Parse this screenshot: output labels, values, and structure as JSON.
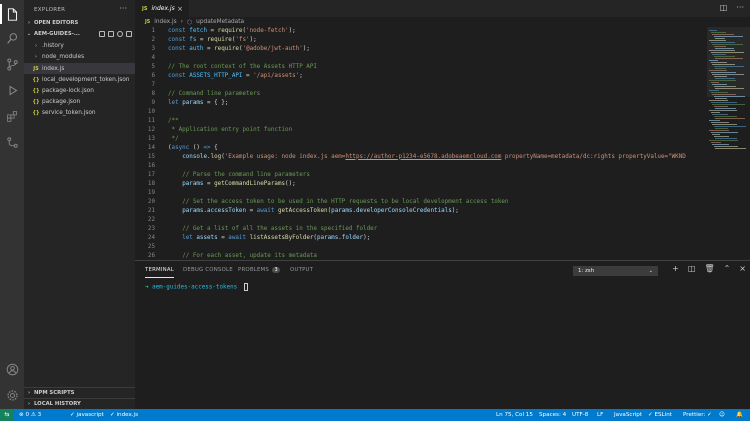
{
  "sidebar": {
    "title": "EXPLORER",
    "more": "···",
    "open_editors": "OPEN EDITORS",
    "project": "AEM-GUIDES-...",
    "items": [
      {
        "label": ".history",
        "kind": "folder"
      },
      {
        "label": "node_modules",
        "kind": "folder"
      },
      {
        "label": "index.js",
        "kind": "js"
      },
      {
        "label": "local_development_token.json",
        "kind": "json"
      },
      {
        "label": "package-lock.json",
        "kind": "json"
      },
      {
        "label": "package.json",
        "kind": "json"
      },
      {
        "label": "service_token.json",
        "kind": "json"
      }
    ],
    "npm_scripts": "NPM SCRIPTS",
    "local_history": "LOCAL HISTORY"
  },
  "editor": {
    "tab_label": "index.js",
    "breadcrumb_file": "index.js",
    "breadcrumb_symbol": "updateMetadata",
    "lines": [
      {
        "n": "1",
        "parts": [
          [
            "kw",
            "const "
          ],
          [
            "vr",
            "fetch"
          ],
          [
            "tx",
            " = "
          ],
          [
            "fn",
            "require"
          ],
          [
            "tx",
            "("
          ],
          [
            "st",
            "'node-fetch'"
          ],
          [
            "tx",
            ");"
          ]
        ]
      },
      {
        "n": "2",
        "parts": [
          [
            "kw",
            "const "
          ],
          [
            "vr",
            "fs"
          ],
          [
            "tx",
            " = "
          ],
          [
            "fn",
            "require"
          ],
          [
            "tx",
            "("
          ],
          [
            "st",
            "'fs'"
          ],
          [
            "tx",
            ");"
          ]
        ]
      },
      {
        "n": "3",
        "parts": [
          [
            "kw",
            "const "
          ],
          [
            "vr",
            "auth"
          ],
          [
            "tx",
            " = "
          ],
          [
            "fn",
            "require"
          ],
          [
            "tx",
            "("
          ],
          [
            "st",
            "'@adobe/jwt-auth'"
          ],
          [
            "tx",
            ");"
          ]
        ]
      },
      {
        "n": "4",
        "parts": []
      },
      {
        "n": "5",
        "parts": [
          [
            "cm",
            "// The root context of the Assets HTTP API"
          ]
        ]
      },
      {
        "n": "6",
        "parts": [
          [
            "kw",
            "const "
          ],
          [
            "vr",
            "ASSETS_HTTP_API"
          ],
          [
            "tx",
            " = "
          ],
          [
            "st",
            "'/api/assets'"
          ],
          [
            "tx",
            ";"
          ]
        ]
      },
      {
        "n": "7",
        "parts": []
      },
      {
        "n": "8",
        "parts": [
          [
            "cm",
            "// Command line parameters"
          ]
        ]
      },
      {
        "n": "9",
        "parts": [
          [
            "kw",
            "let "
          ],
          [
            "id",
            "params"
          ],
          [
            "tx",
            " = { };"
          ]
        ]
      },
      {
        "n": "10",
        "parts": []
      },
      {
        "n": "11",
        "parts": [
          [
            "cm",
            "/**"
          ]
        ]
      },
      {
        "n": "12",
        "parts": [
          [
            "cm",
            " * Application entry point function"
          ]
        ]
      },
      {
        "n": "13",
        "parts": [
          [
            "cm",
            " */"
          ]
        ]
      },
      {
        "n": "14",
        "parts": [
          [
            "tx",
            "("
          ],
          [
            "kw",
            "async "
          ],
          [
            "tx",
            "() "
          ],
          [
            "kw",
            "=>"
          ],
          [
            "tx",
            " {"
          ]
        ]
      },
      {
        "n": "15",
        "parts": [
          [
            "tx",
            "    "
          ],
          [
            "id",
            "console"
          ],
          [
            "tx",
            "."
          ],
          [
            "fn",
            "log"
          ],
          [
            "tx",
            "("
          ],
          [
            "st",
            "'Example usage: node index.js aem="
          ],
          [
            "stu",
            "https://author-p1234-e5678.adobeaemcloud.com"
          ],
          [
            "st",
            " propertyName=metadata/dc:rights propertyValue=\"WKND"
          ]
        ]
      },
      {
        "n": "16",
        "parts": []
      },
      {
        "n": "17",
        "parts": [
          [
            "tx",
            "    "
          ],
          [
            "cm",
            "// Parse the command line parameters"
          ]
        ]
      },
      {
        "n": "18",
        "parts": [
          [
            "tx",
            "    "
          ],
          [
            "id",
            "params"
          ],
          [
            "tx",
            " = "
          ],
          [
            "fn",
            "getCommandLineParams"
          ],
          [
            "tx",
            "();"
          ]
        ]
      },
      {
        "n": "19",
        "parts": []
      },
      {
        "n": "20",
        "parts": [
          [
            "tx",
            "    "
          ],
          [
            "cm",
            "// Set the access token to be used in the HTTP requests to be local development access token"
          ]
        ]
      },
      {
        "n": "21",
        "parts": [
          [
            "tx",
            "    "
          ],
          [
            "id",
            "params"
          ],
          [
            "tx",
            "."
          ],
          [
            "id",
            "accessToken"
          ],
          [
            "tx",
            " = "
          ],
          [
            "kw",
            "await "
          ],
          [
            "fn",
            "getAccessToken"
          ],
          [
            "tx",
            "("
          ],
          [
            "id",
            "params"
          ],
          [
            "tx",
            "."
          ],
          [
            "id",
            "developerConsoleCredentials"
          ],
          [
            "tx",
            ");"
          ]
        ]
      },
      {
        "n": "22",
        "parts": []
      },
      {
        "n": "23",
        "parts": [
          [
            "tx",
            "    "
          ],
          [
            "cm",
            "// Get a list of all the assets in the specified folder"
          ]
        ]
      },
      {
        "n": "24",
        "parts": [
          [
            "tx",
            "    "
          ],
          [
            "kw",
            "let "
          ],
          [
            "id",
            "assets"
          ],
          [
            "tx",
            " = "
          ],
          [
            "kw",
            "await "
          ],
          [
            "fn",
            "listAssetsByFolder"
          ],
          [
            "tx",
            "("
          ],
          [
            "id",
            "params"
          ],
          [
            "tx",
            "."
          ],
          [
            "id",
            "folder"
          ],
          [
            "tx",
            ");"
          ]
        ]
      },
      {
        "n": "25",
        "parts": []
      },
      {
        "n": "26",
        "parts": [
          [
            "tx",
            "    "
          ],
          [
            "cm",
            "// For each asset, update its metadata"
          ]
        ]
      }
    ]
  },
  "panel": {
    "tabs": [
      "TERMINAL",
      "DEBUG CONSOLE",
      "PROBLEMS",
      "OUTPUT"
    ],
    "problems_count": "3",
    "terminal_select": "1: zsh",
    "prompt_arrow": "➜",
    "prompt_path": "aem-guides-access-tokens"
  },
  "status": {
    "errors": "0",
    "warnings": "3",
    "language_scope": "javascript",
    "file": "index.js",
    "position": "Ln 75, Col 15",
    "spaces": "Spaces: 4",
    "encoding": "UTF-8",
    "eol": "LF",
    "language": "JavaScript",
    "eslint": "ESLint",
    "prettier": "Prettier:"
  },
  "colors": {
    "status_bar": "#007acc",
    "remote": "#16825d",
    "activity_bar": "#333333",
    "sidebar": "#252526",
    "editor": "#1e1e1e"
  }
}
